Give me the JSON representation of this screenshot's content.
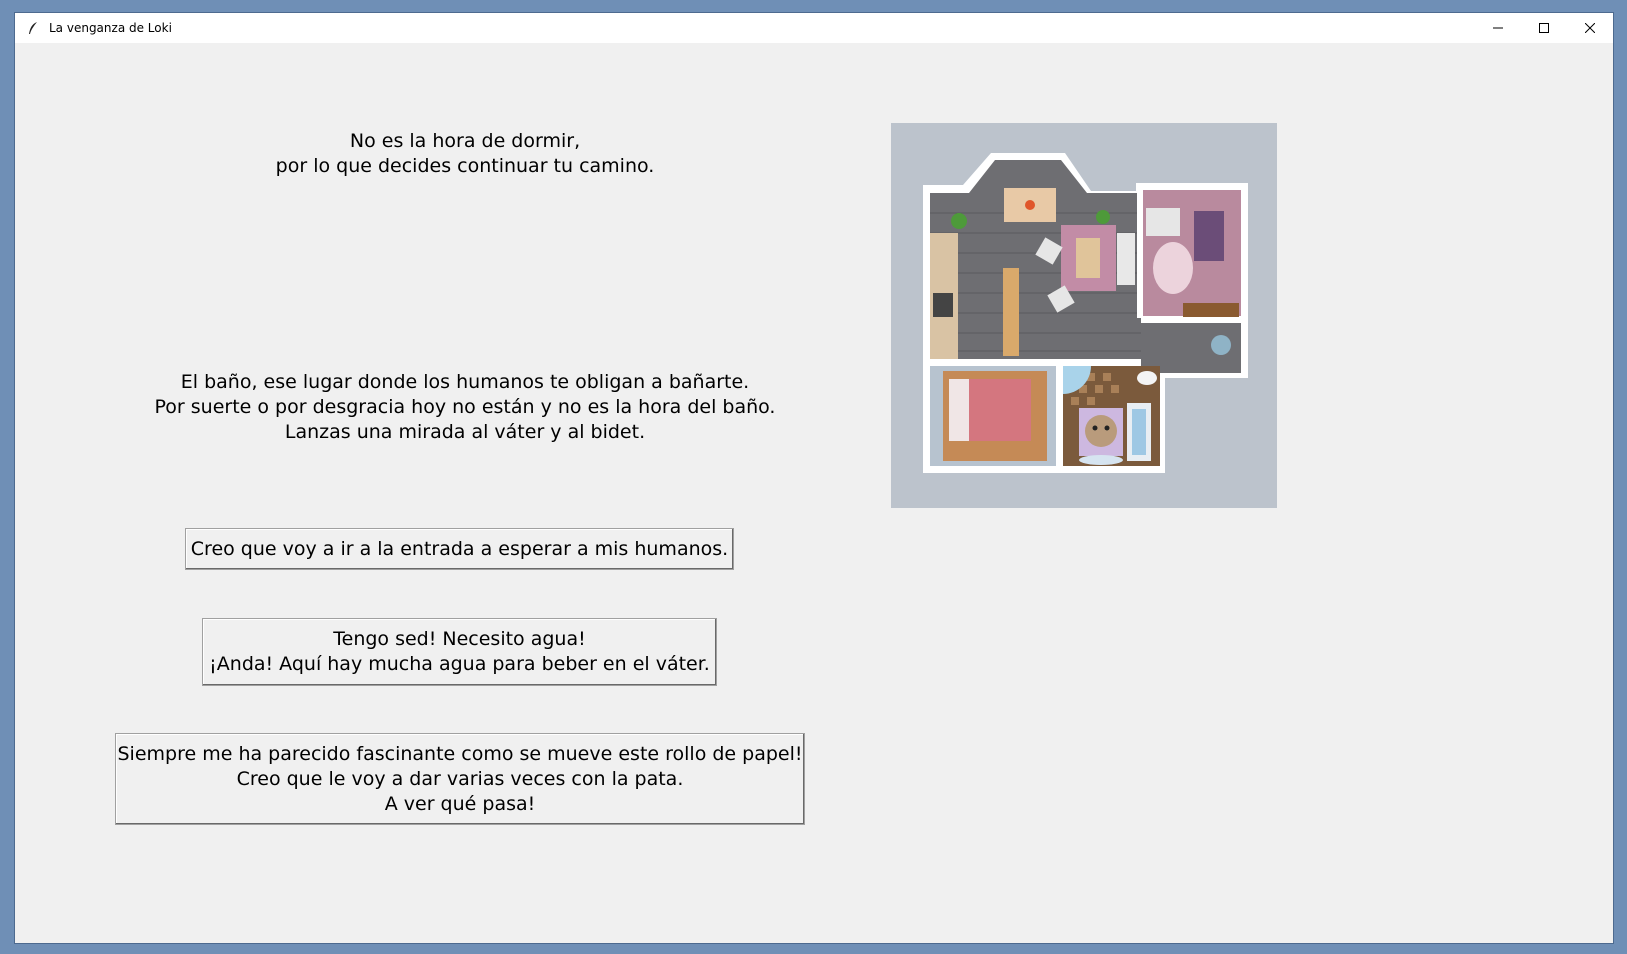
{
  "window": {
    "title": "La venganza de Loki",
    "icons": {
      "app": "feather-icon",
      "minimize": "minimize-icon",
      "maximize": "maximize-icon",
      "close": "close-icon"
    }
  },
  "scene": {
    "intro_text": "No es la hora de dormir,\npor lo que decides continuar tu camino.",
    "description": "El baño, ese lugar donde los humanos te obligan a bañarte.\nPor suerte o por desgracia hoy no están y no es la hora del baño.\nLanzas una mirada al váter y al bidet."
  },
  "choices": [
    {
      "label": "Creo que voy a ir a la entrada a esperar a mis humanos."
    },
    {
      "label": "Tengo sed! Necesito agua!\n¡Anda! Aquí hay mucha agua para beber en el váter."
    },
    {
      "label": "Siempre me ha parecido fascinante como se mueve este rollo de papel!\nCreo que le voy a dar varias veces con la pata.\nA ver qué pasa!"
    }
  ],
  "colors": {
    "background": "#f0f0f0",
    "floor_wood": "#6e6e72",
    "bedroom_bed": "#d4767f",
    "bathroom_tile": "#7b5a3c",
    "bath_water": "#9ec8e4"
  }
}
